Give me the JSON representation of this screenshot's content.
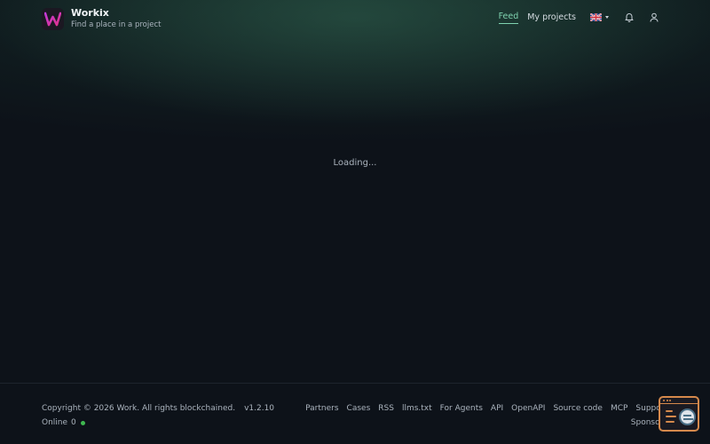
{
  "header": {
    "brand_name": "Workix",
    "tagline": "Find a place in a project",
    "nav": {
      "feed": "Feed",
      "my_projects": "My projects"
    },
    "language_flag": "uk-flag-icon",
    "icons": [
      "bell-icon",
      "user-icon"
    ]
  },
  "main": {
    "status": "Loading..."
  },
  "footer": {
    "copyright": "Copyright © 2026 Work. All rights blockchained.",
    "version": "v1.2.10",
    "online_label": "Online",
    "online_count": "0",
    "links": {
      "partners": "Partners",
      "cases": "Cases",
      "rss": "RSS",
      "llms": "llms.txt",
      "for_agents": "For Agents",
      "api": "API",
      "openapi": "OpenAPI",
      "source_code": "Source code",
      "mcp": "MCP",
      "support": "Support",
      "sponsors": "Sponsors"
    }
  },
  "colors": {
    "background": "#0d1219",
    "accent": "#7fd3b0",
    "online_dot": "#3fb950",
    "widget_border": "#d5894c"
  }
}
